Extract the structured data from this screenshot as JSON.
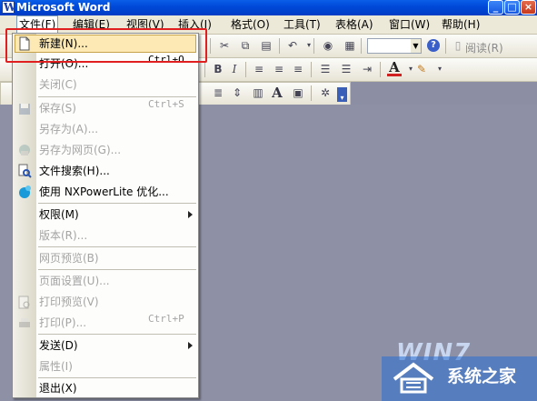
{
  "window": {
    "title": "Microsoft Word",
    "app_icon_letter": "W"
  },
  "menubar": [
    {
      "label": "文件(F)"
    },
    {
      "label": "编辑(E)"
    },
    {
      "label": "视图(V)"
    },
    {
      "label": "插入(I)"
    },
    {
      "label": "格式(O)"
    },
    {
      "label": "工具(T)"
    },
    {
      "label": "表格(A)"
    },
    {
      "label": "窗口(W)"
    },
    {
      "label": "帮助(H)"
    }
  ],
  "toolbar": {
    "read_label": "阅读(R)",
    "bold": "B",
    "italic": "I",
    "text_a": "A"
  },
  "file_menu": {
    "new": {
      "label": "新建(N)..."
    },
    "open": {
      "label": "打开(O)...",
      "shortcut": "Ctrl+O"
    },
    "close": {
      "label": "关闭(C)"
    },
    "save": {
      "label": "保存(S)",
      "shortcut": "Ctrl+S"
    },
    "save_as": {
      "label": "另存为(A)..."
    },
    "save_as_web": {
      "label": "另存为网页(G)..."
    },
    "file_search": {
      "label": "文件搜索(H)..."
    },
    "nxpowerlite": {
      "label": "使用 NXPowerLite 优化..."
    },
    "permission": {
      "label": "权限(M)"
    },
    "versions": {
      "label": "版本(R)..."
    },
    "web_preview": {
      "label": "网页预览(B)"
    },
    "page_setup": {
      "label": "页面设置(U)..."
    },
    "print_preview": {
      "label": "打印预览(V)"
    },
    "print": {
      "label": "打印(P)...",
      "shortcut": "Ctrl+P"
    },
    "send_to": {
      "label": "发送(D)"
    },
    "properties": {
      "label": "属性(I)"
    },
    "exit": {
      "label": "退出(X)"
    }
  },
  "watermark": {
    "logo": "WIN7",
    "site": "系统之家"
  },
  "colors": {
    "highlight_border": "#e02020",
    "menu_hover": "#fce9b4",
    "titlebar": "#0048d8"
  }
}
